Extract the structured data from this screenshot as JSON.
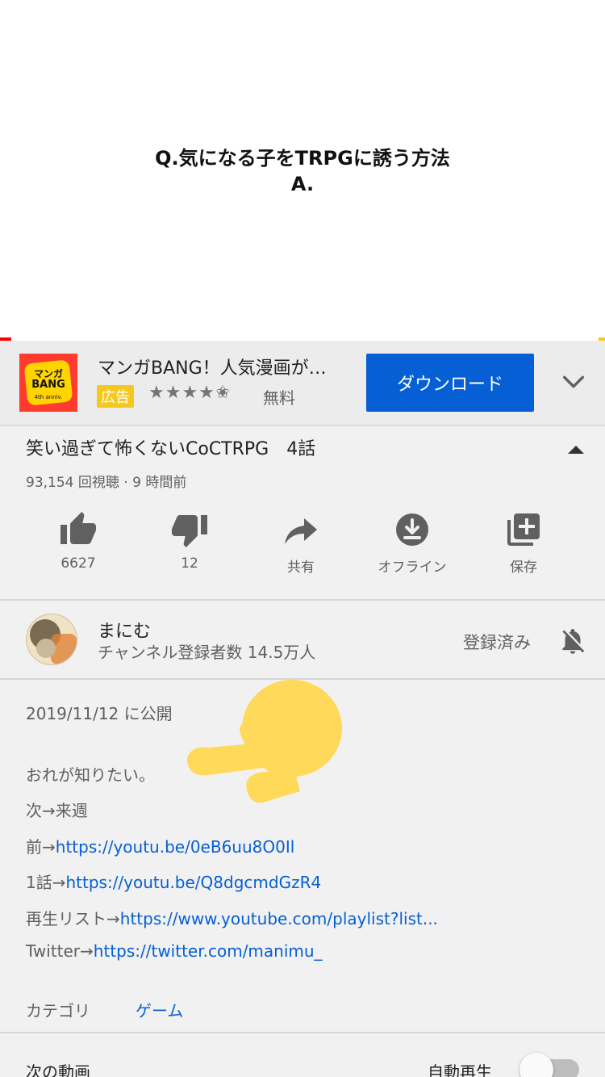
{
  "video": {
    "caption_line1": "Q.気になる子をTRPGに誘う方法",
    "caption_line2": "A."
  },
  "ad": {
    "logo_line1": "マンガ",
    "logo_line2": "BANG",
    "logo_line3": "4th anniv.",
    "title": "マンガBANG！人気漫画が…",
    "badge": "広告",
    "rating_stars": "★★★★✬",
    "price": "無料",
    "cta_label": "ダウンロード"
  },
  "info": {
    "title": "笑い過ぎて怖くないCoCTRPG　4話",
    "meta": "93,154 回視聴 · 9 時間前",
    "actions": [
      {
        "label": "6627",
        "icon": "thumbs-up-icon"
      },
      {
        "label": "12",
        "icon": "thumbs-down-icon"
      },
      {
        "label": "共有",
        "icon": "share-icon"
      },
      {
        "label": "オフライン",
        "icon": "download-icon"
      },
      {
        "label": "保存",
        "icon": "playlist-add-icon"
      }
    ]
  },
  "channel": {
    "name": "まにむ",
    "subscribers": "チャンネル登録者数 14.5万人",
    "subscribed_label": "登録済み"
  },
  "description": {
    "published": "2019/11/12 に公開",
    "line1": "おれが知りたい。",
    "line2": "次→来週",
    "line3_prefix": "前→",
    "line3_link": "https://youtu.be/0eB6uu8O0Il",
    "line4_prefix": "1話→",
    "line4_link": "https://youtu.be/Q8dgcmdGzR4",
    "line5_prefix": "再生リスト→",
    "line5_link": "https://www.youtube.com/playlist?list...",
    "line6_prefix": "Twitter→",
    "line6_link": "https://twitter.com/manimu_",
    "category_label": "カテゴリ",
    "category_value": "ゲーム"
  },
  "next": {
    "label": "次の動画",
    "autoplay_label": "自動再生",
    "autoplay_on": false
  },
  "colors": {
    "accent_blue": "#065fd4",
    "progress_red": "#ff0000",
    "ad_badge_yellow": "#f6c81e",
    "pointer_yellow": "#ffd95a"
  }
}
